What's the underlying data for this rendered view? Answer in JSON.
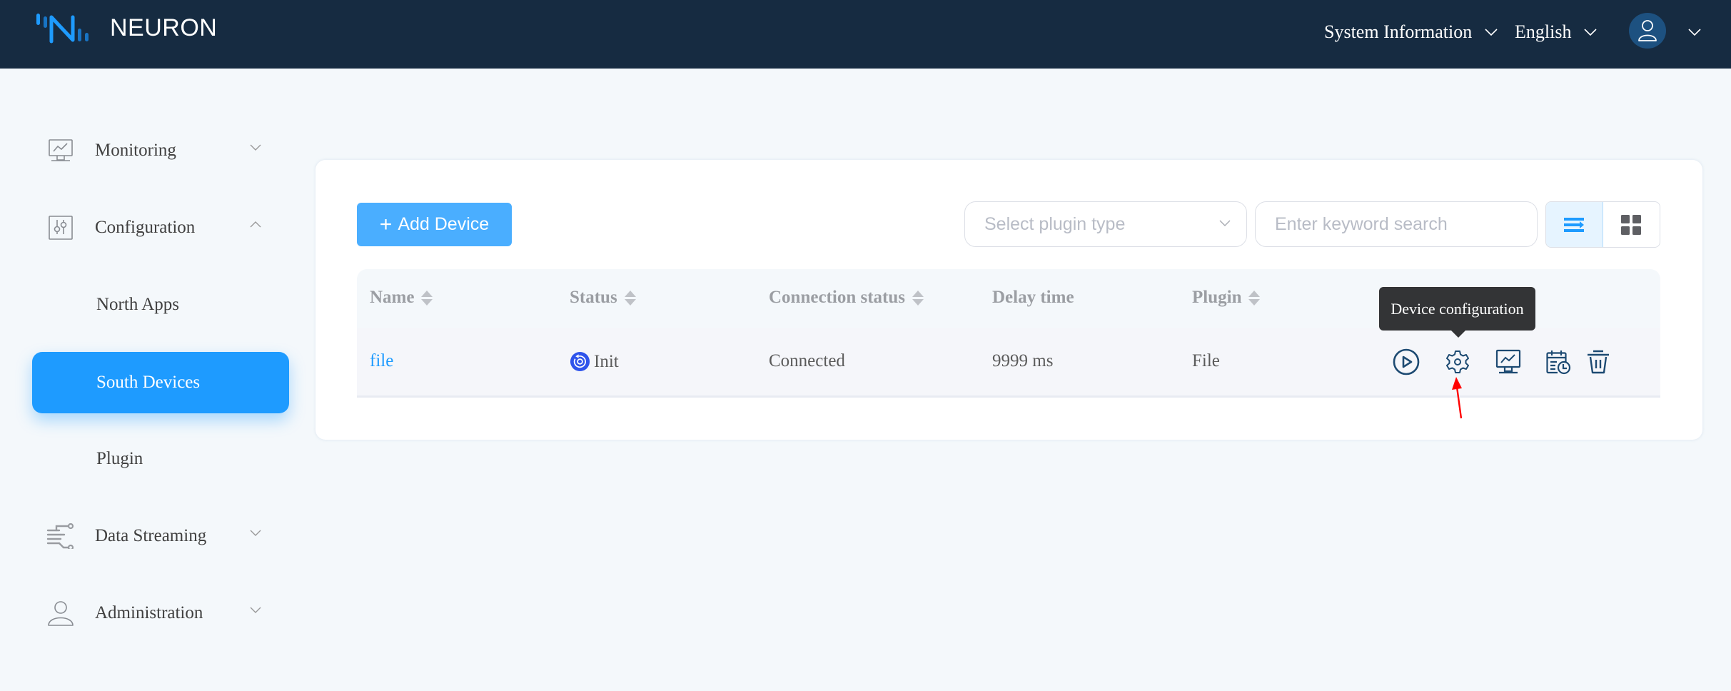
{
  "header": {
    "brand": "NEURON",
    "system_info_label": "System Information",
    "language_label": "English",
    "user_icon": "user-icon"
  },
  "sidebar": {
    "items": [
      {
        "label": "Monitoring",
        "icon": "monitor-chart-icon",
        "expanded": false
      },
      {
        "label": "Configuration",
        "icon": "sliders-icon",
        "expanded": true
      },
      {
        "label": "North Apps",
        "sub": true
      },
      {
        "label": "South Devices",
        "sub": true,
        "active": true
      },
      {
        "label": "Plugin",
        "sub": true
      },
      {
        "label": "Data Streaming",
        "icon": "data-stream-icon",
        "expanded": false
      },
      {
        "label": "Administration",
        "icon": "user-icon",
        "expanded": false
      }
    ]
  },
  "toolbar": {
    "add_label": "Add Device",
    "plugin_select_placeholder": "Select plugin type",
    "search_placeholder": "Enter keyword search",
    "view_modes": [
      "list",
      "card"
    ],
    "active_view": "list"
  },
  "table": {
    "columns": [
      {
        "label": "Name",
        "sortable": true
      },
      {
        "label": "Status",
        "sortable": true
      },
      {
        "label": "Connection status",
        "sortable": true
      },
      {
        "label": "Delay time",
        "sortable": false
      },
      {
        "label": "Plugin",
        "sortable": true
      },
      {
        "label": "",
        "sortable": false
      }
    ],
    "rows": [
      {
        "name": "file",
        "status": "Init",
        "connection_status": "Connected",
        "delay_time": "9999 ms",
        "plugin": "File",
        "actions": [
          "start",
          "device-configuration",
          "data-monitoring",
          "data-statistics",
          "delete"
        ]
      }
    ]
  },
  "tooltip": {
    "text": "Device configuration"
  },
  "colors": {
    "header_bg": "#162b41",
    "accent": "#1e9bff",
    "add_button": "#4aaeff",
    "action_icon": "#1d4a72",
    "status_init": "#2f54eb",
    "annotation_arrow": "#ff0000"
  }
}
